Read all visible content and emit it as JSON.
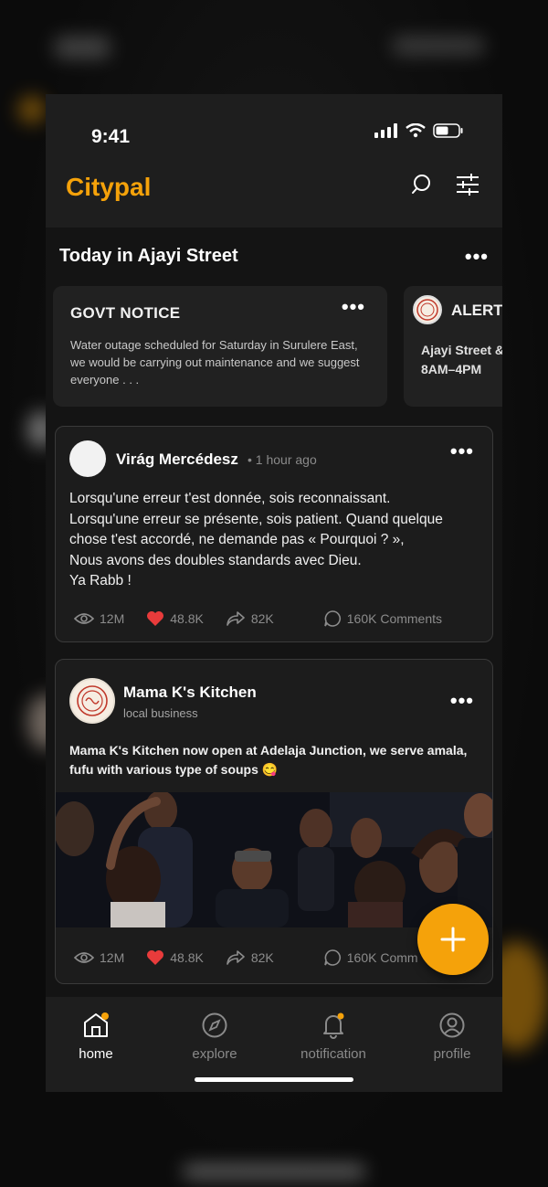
{
  "status_bar": {
    "time": "9:41"
  },
  "app": {
    "brand": "Citypal"
  },
  "icons": {
    "search": "search-icon",
    "filter": "sliders-icon",
    "more": "more-dots-icon",
    "view": "eye-icon",
    "like": "heart-icon",
    "share": "share-arrow-icon",
    "comment": "comment-bubble-icon",
    "add": "plus-icon"
  },
  "colors": {
    "accent": "#f5a20a",
    "like": "#e83b3b",
    "background": "#141414",
    "card": "#1c1c1c"
  },
  "section": {
    "title": "Today in Ajayi Street"
  },
  "notices": [
    {
      "title": "GOVT NOTICE",
      "body": "Water outage scheduled for Saturday in Surulere East, we would be carrying out maintenance and we suggest everyone . . ."
    },
    {
      "title": "ALERT",
      "body": "Ajayi Street & 8AM–4PM"
    }
  ],
  "posts": [
    {
      "author": "Virág Mercédesz",
      "time": "1 hour ago",
      "text_lines": [
        "Lorsqu'une erreur t'est donnée, sois reconnaissant.",
        "Lorsqu'une erreur se présente, sois patient. Quand quelque",
        "chose t'est accordé, ne demande pas « Pourquoi ? »,",
        "Nous avons des doubles standards avec Dieu.",
        "Ya Rabb !"
      ],
      "views": "12M",
      "likes": "48.8K",
      "shares": "82K",
      "comments": "160K Comments"
    },
    {
      "author": "Mama K's Kitchen",
      "subtitle": "local business",
      "text": "Mama K's Kitchen now open at Adelaja Junction, we serve amala, fufu with various type of soups 😋",
      "views": "12M",
      "likes": "48.8K",
      "shares": "82K",
      "comments": "160K Comm"
    }
  ],
  "nav": [
    {
      "label": "home",
      "icon": "home-icon",
      "active": true
    },
    {
      "label": "explore",
      "icon": "compass-icon",
      "active": false
    },
    {
      "label": "notification",
      "icon": "bell-icon",
      "active": false
    },
    {
      "label": "profile",
      "icon": "user-icon",
      "active": false
    }
  ]
}
